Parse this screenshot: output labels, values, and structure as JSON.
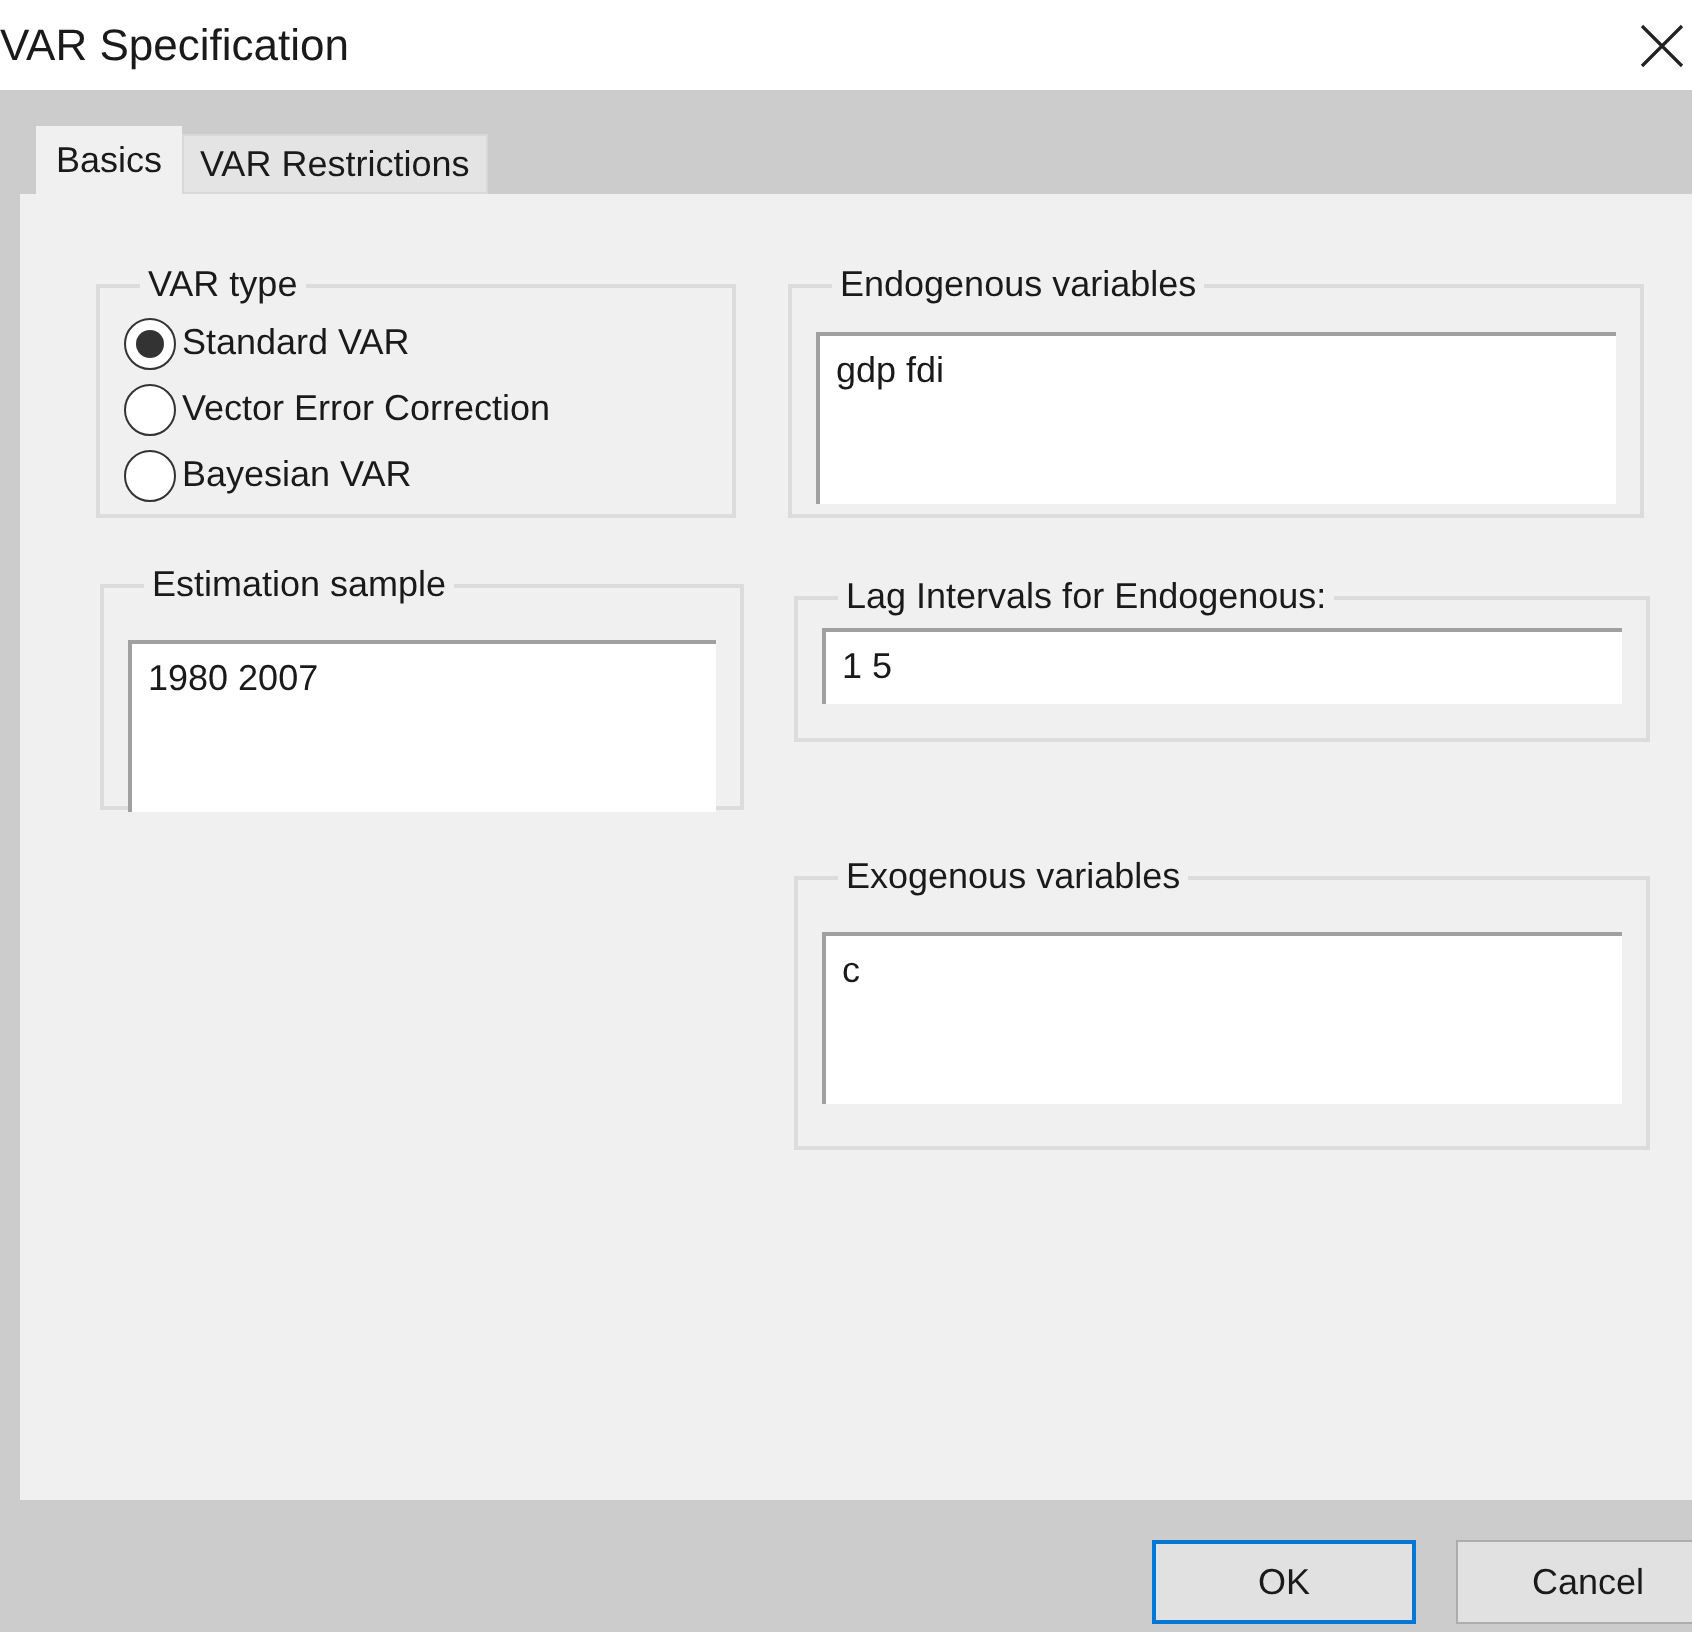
{
  "window": {
    "title": "VAR Specification"
  },
  "tabs": [
    {
      "label": "Basics",
      "selected": true
    },
    {
      "label": "VAR Restrictions",
      "selected": false
    }
  ],
  "var_type": {
    "legend": "VAR type",
    "options": [
      {
        "label": "Standard VAR",
        "selected": true
      },
      {
        "label": "Vector Error Correction",
        "selected": false
      },
      {
        "label": "Bayesian VAR",
        "selected": false
      }
    ]
  },
  "estimation_sample": {
    "legend": "Estimation sample",
    "value": "1980 2007"
  },
  "endogenous_variables": {
    "legend": "Endogenous variables",
    "value": "gdp fdi"
  },
  "lag_intervals": {
    "legend": "Lag Intervals for Endogenous:",
    "value": "1 5"
  },
  "exogenous_variables": {
    "legend": "Exogenous variables",
    "value": "c"
  },
  "buttons": [
    {
      "label": "OK",
      "default": true
    },
    {
      "label": "Cancel",
      "default": false
    }
  ]
}
